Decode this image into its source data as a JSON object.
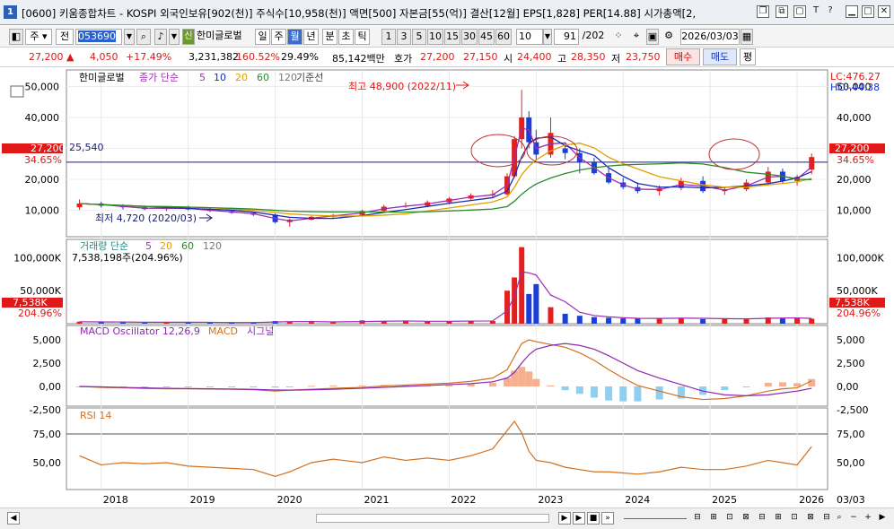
{
  "window": {
    "app_icon": "1",
    "title": "[0600] 키움종합차트 - KOSPI 외국인보유[902(천)] 주식수[10,958(천)] 액면[500] 자본금[55(억)] 결산[12월] EPS[1,828] PER[14.88] 시가총액[2,"
  },
  "toolbar": {
    "period_select": "주",
    "type_select": "전",
    "code_input": "053690",
    "stock_name": "한미글로벌",
    "period_tabs": [
      "일",
      "주",
      "월",
      "년",
      "분",
      "초",
      "틱"
    ],
    "active_period": "월",
    "intervals": [
      "1",
      "3",
      "5",
      "10",
      "15",
      "30",
      "45",
      "60"
    ],
    "interval_value": "10",
    "count_display": "91",
    "count_total": "/202",
    "date_value": "2026/03/03"
  },
  "quote": {
    "price": "27,200",
    "change_arrow": "▲",
    "change": "4,050",
    "change_pct": "+17.49%",
    "volume": "3,231,382",
    "volume_ratio": "160.52%",
    "turnover": "29.49%",
    "amount": "85,142백만",
    "hoga_label": "호가",
    "hoga_ask": "27,200",
    "hoga_bid": "27,150",
    "open_label": "시",
    "open": "24,400",
    "high_label": "고",
    "high": "28,350",
    "low_label": "저",
    "low": "23,750",
    "buy_button": "매수",
    "sell_button": "매도",
    "eval_button": "평"
  },
  "price_panel": {
    "legend_name": "한미글로벌",
    "legend_ma_label": "종가 단순",
    "legend_ma_periods": [
      "5",
      "10",
      "20",
      "60",
      "120"
    ],
    "legend_baseline": "기준선",
    "yticks": [
      "50,000",
      "40,000",
      "30,000",
      "20,000",
      "10,000"
    ],
    "price_tag": "27,200",
    "pct_tag": "34.65%",
    "lc_label": "LC:476.27",
    "hc_label": "HC:-44.38",
    "baseline_label": "25,540",
    "high_annotation": "최고 48,900 (2022/11)",
    "low_annotation": "최저 4,720 (2020/03)"
  },
  "volume_panel": {
    "legend_label": "거래량 단순",
    "legend_periods": [
      "5",
      "20",
      "60",
      "120"
    ],
    "current_label": "7,538,198주(204.96%)",
    "yticks": [
      "100,000K",
      "50,000K"
    ],
    "value_tag": "7,538K",
    "pct_tag": "204.96%"
  },
  "macd_panel": {
    "legend_osc": "MACD Oscillator 12,26,9",
    "legend_macd": "MACD",
    "legend_signal": "시그널",
    "yticks": [
      "5,000",
      "2,500",
      "0,00",
      "-2,500"
    ]
  },
  "rsi_panel": {
    "legend": "RSI 14",
    "yticks": [
      "75,00",
      "50,00"
    ]
  },
  "x_axis": {
    "labels": [
      "2018",
      "2019",
      "2020",
      "2021",
      "2022",
      "2023",
      "2024",
      "2025",
      "2026"
    ],
    "last_label": "03/03"
  },
  "colors": {
    "up": "#e32020",
    "down": "#1b3ed8",
    "ma5": "#9b2fb0",
    "ma10": "#1b2ab0",
    "ma20": "#e0a000",
    "ma60": "#2a8a2a",
    "ma120": "#777777",
    "baseline": "#1a1a6e",
    "macd": "#d07020",
    "signal": "#8a2ab0",
    "osc_pos": "#f4b090",
    "osc_neg": "#90cff0",
    "rsi": "#d07020"
  },
  "chart_data": {
    "type": "candlestick",
    "x": [
      "2017-10",
      "2018-01",
      "2018-04",
      "2018-07",
      "2018-10",
      "2019-01",
      "2019-04",
      "2019-07",
      "2019-10",
      "2020-01",
      "2020-03",
      "2020-06",
      "2020-09",
      "2021-01",
      "2021-04",
      "2021-07",
      "2021-10",
      "2022-01",
      "2022-04",
      "2022-07",
      "2022-09",
      "2022-10",
      "2022-11",
      "2022-12",
      "2023-01",
      "2023-03",
      "2023-05",
      "2023-07",
      "2023-09",
      "2023-11",
      "2024-01",
      "2024-03",
      "2024-06",
      "2024-09",
      "2024-12",
      "2025-03",
      "2025-06",
      "2025-09",
      "2025-11",
      "2026-01",
      "2026-03"
    ],
    "ohlc": [
      [
        11000,
        13500,
        10200,
        12200
      ],
      [
        12200,
        12800,
        10900,
        11500
      ],
      [
        11500,
        12000,
        10300,
        11000
      ],
      [
        11000,
        11600,
        10100,
        10400
      ],
      [
        10400,
        11200,
        9800,
        10900
      ],
      [
        10900,
        11500,
        10000,
        10300
      ],
      [
        10300,
        10800,
        9500,
        9800
      ],
      [
        9800,
        10200,
        8900,
        9200
      ],
      [
        9200,
        9600,
        8200,
        8600
      ],
      [
        8600,
        9000,
        5800,
        6200
      ],
      [
        6200,
        7400,
        4720,
        7000
      ],
      [
        7000,
        8200,
        6800,
        7900
      ],
      [
        7900,
        8800,
        7600,
        8500
      ],
      [
        8500,
        10200,
        8200,
        9800
      ],
      [
        9800,
        11800,
        9600,
        11200
      ],
      [
        11200,
        12600,
        10800,
        11500
      ],
      [
        11500,
        13200,
        11000,
        12600
      ],
      [
        12600,
        14300,
        12000,
        13800
      ],
      [
        13800,
        15500,
        13200,
        14800
      ],
      [
        14800,
        16500,
        14000,
        15200
      ],
      [
        15200,
        22000,
        14800,
        21000
      ],
      [
        21000,
        34000,
        20500,
        33000
      ],
      [
        33000,
        48900,
        30000,
        40000
      ],
      [
        40000,
        42000,
        30000,
        32000
      ],
      [
        32000,
        36000,
        26000,
        28000
      ],
      [
        28000,
        40000,
        27000,
        35000
      ],
      [
        30000,
        32000,
        26500,
        28500
      ],
      [
        28500,
        30000,
        22000,
        25500
      ],
      [
        25500,
        27000,
        21500,
        22000
      ],
      [
        22000,
        23500,
        18500,
        19000
      ],
      [
        19000,
        20500,
        16800,
        17500
      ],
      [
        17500,
        19000,
        15500,
        16200
      ],
      [
        16200,
        18000,
        14800,
        17200
      ],
      [
        17200,
        20500,
        16500,
        19500
      ],
      [
        19500,
        21000,
        15600,
        16200
      ],
      [
        16200,
        17500,
        15000,
        16800
      ],
      [
        16800,
        20000,
        16200,
        19000
      ],
      [
        19000,
        24000,
        18500,
        22500
      ],
      [
        22500,
        23500,
        18800,
        19500
      ],
      [
        19500,
        21500,
        18000,
        20800
      ],
      [
        23150,
        28350,
        21600,
        27200
      ]
    ],
    "volume_thousands": [
      3000,
      2500,
      2000,
      2000,
      2500,
      2000,
      1800,
      1500,
      2000,
      4000,
      3500,
      2500,
      2200,
      5000,
      4000,
      3500,
      3500,
      4000,
      4500,
      4000,
      50000,
      70000,
      116000,
      45000,
      60000,
      25000,
      15000,
      12000,
      10000,
      9000,
      8000,
      7500,
      8500,
      9000,
      7000,
      7000,
      8000,
      9500,
      8000,
      8500,
      7538
    ],
    "macd": [
      0,
      -100,
      -150,
      -220,
      -250,
      -260,
      -280,
      -300,
      -350,
      -500,
      -400,
      -300,
      -200,
      -100,
      50,
      150,
      250,
      350,
      550,
      900,
      1800,
      3200,
      4600,
      5000,
      4800,
      4500,
      4200,
      3600,
      2800,
      1800,
      900,
      100,
      -500,
      -1100,
      -1400,
      -1300,
      -1000,
      -500,
      -250,
      -150,
      600
    ],
    "signal": [
      0,
      -50,
      -100,
      -150,
      -200,
      -230,
      -250,
      -280,
      -310,
      -380,
      -400,
      -360,
      -300,
      -200,
      -100,
      0,
      100,
      200,
      300,
      500,
      900,
      1500,
      2500,
      3400,
      4000,
      4400,
      4600,
      4400,
      4000,
      3300,
      2500,
      1700,
      900,
      200,
      -500,
      -900,
      -1000,
      -900,
      -700,
      -500,
      -200
    ],
    "rsi": [
      56,
      48,
      50,
      49,
      50,
      47,
      46,
      45,
      44,
      38,
      42,
      50,
      53,
      50,
      55,
      52,
      54,
      52,
      56,
      62,
      78,
      86,
      76,
      60,
      52,
      50,
      46,
      44,
      42,
      42,
      41,
      40,
      42,
      46,
      44,
      44,
      47,
      52,
      50,
      48,
      64
    ]
  }
}
